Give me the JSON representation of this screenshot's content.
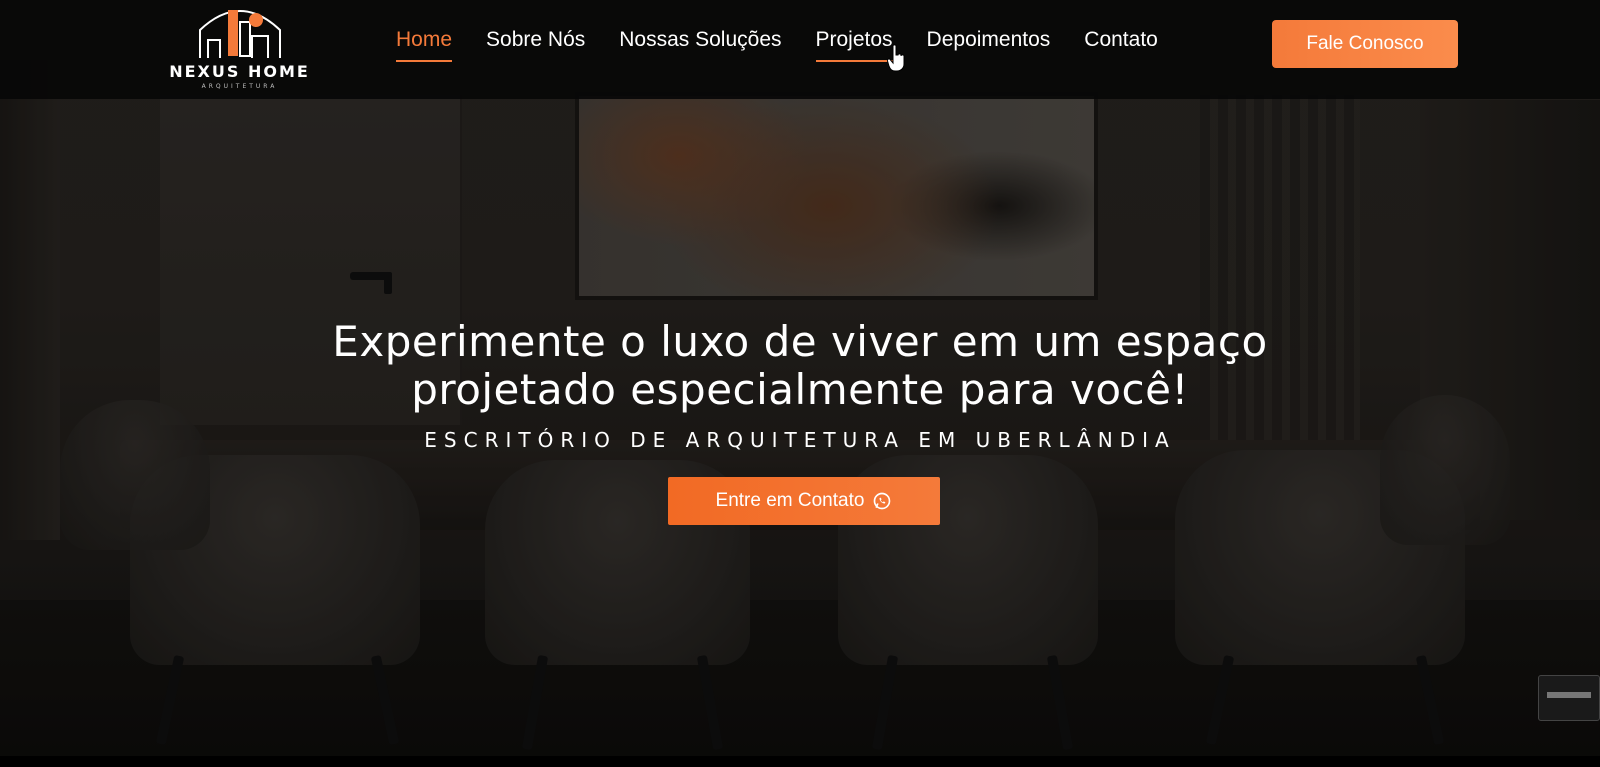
{
  "brand": {
    "name": "NEXUS HOME",
    "tagline": "ARQUITETURA"
  },
  "nav": {
    "items": [
      {
        "label": "Home"
      },
      {
        "label": "Sobre Nós"
      },
      {
        "label": "Nossas Soluções"
      },
      {
        "label": "Projetos"
      },
      {
        "label": "Depoimentos"
      },
      {
        "label": "Contato"
      }
    ],
    "active_item": "Home",
    "hovered_item": "Projetos",
    "cta_label": "Fale Conosco"
  },
  "hero": {
    "headline_line1": "Experimente o luxo de viver em um espaço",
    "headline_line2": "projetado especialmente para você!",
    "subtitle": "ESCRITÓRIO DE ARQUITETURA EM UBERLÂNDIA",
    "cta_label": "Entre em Contato",
    "cta_icon": "whatsapp-icon"
  },
  "colors": {
    "accent": "#f47a3a",
    "navbar_bg": "#080808",
    "text": "#ffffff"
  }
}
